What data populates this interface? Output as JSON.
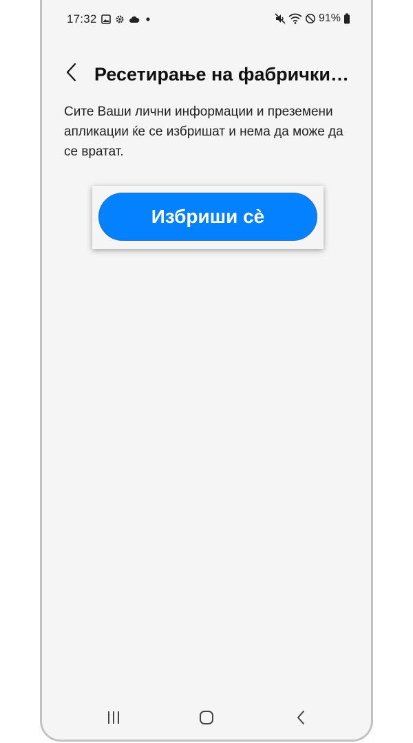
{
  "status_bar": {
    "time": "17:32",
    "battery": "91%",
    "left_icons": [
      "gallery-icon",
      "gear-icon",
      "cloud-icon",
      "dot-icon"
    ],
    "right_icons": [
      "mute-vibrate-icon",
      "wifi-icon",
      "do-not-disturb-icon",
      "battery-icon"
    ]
  },
  "header": {
    "title": "Ресетирање на фабричкит…",
    "back_icon": "chevron-left-icon"
  },
  "main": {
    "description": "Сите Ваши лични информации и преземени апликации ќе се избришат и нема да може да се вратат.",
    "delete_button_label": "Избриши сè"
  },
  "nav_bar": {
    "items": [
      "recent-apps-icon",
      "home-icon",
      "back-icon"
    ]
  },
  "colors": {
    "accent": "#0381fe",
    "background": "#f5f5f5",
    "text": "#111111"
  }
}
